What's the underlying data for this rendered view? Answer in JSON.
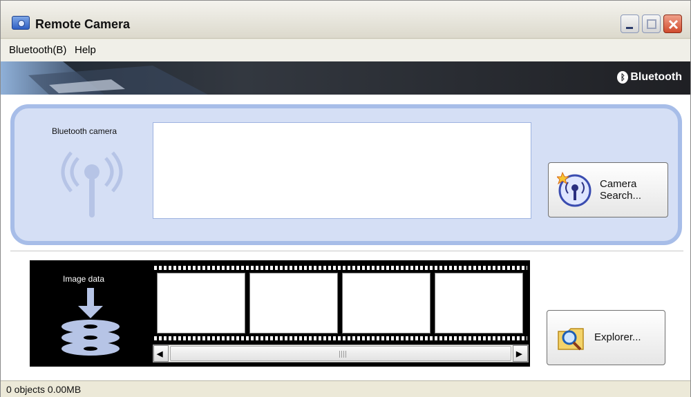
{
  "window": {
    "title": "Remote Camera",
    "icon": "camera-app-icon",
    "controls": [
      "minimize",
      "maximize",
      "close"
    ]
  },
  "menu": {
    "items": [
      {
        "label": "Bluetooth(B)"
      },
      {
        "label": "Help"
      }
    ]
  },
  "banner": {
    "brand": "Bluetooth",
    "brand_icon": "bluetooth-icon"
  },
  "camera_panel": {
    "label": "Bluetooth camera",
    "icon": "antenna-icon",
    "list_items": [],
    "search_button": {
      "label_line1": "Camera",
      "label_line2": "Search...",
      "icon": "camera-search-icon"
    }
  },
  "image_panel": {
    "label": "Image data",
    "icon": "image-data-icon",
    "frames": [
      "",
      "",
      "",
      ""
    ]
  },
  "explorer_button": {
    "label": "Explorer...",
    "icon": "magnifier-folder-icon"
  },
  "status": {
    "text": "0 objects 0.00MB"
  },
  "colors": {
    "panel_bg": "#d5dff5",
    "panel_border": "#a7bde8",
    "banner_dark": "#1f2024",
    "close_red": "#d04a2c"
  }
}
